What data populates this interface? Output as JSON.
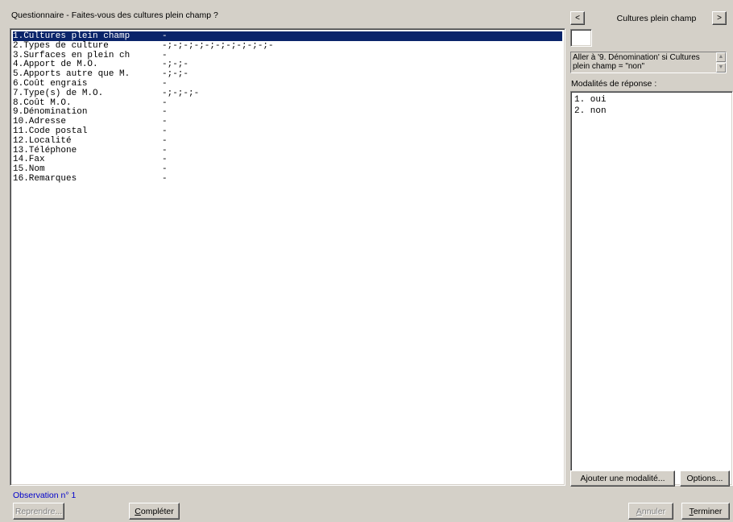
{
  "window": {
    "title": "Questionnaire - Faites-vous des cultures plein champ ?"
  },
  "questions": [
    {
      "label": "1.Cultures plein champ",
      "value": "-"
    },
    {
      "label": "2.Types de culture",
      "value": "-;-;-;-;-;-;-;-;-;-;-"
    },
    {
      "label": "3.Surfaces en plein ch",
      "value": "-"
    },
    {
      "label": "4.Apport de M.O.",
      "value": "-;-;-"
    },
    {
      "label": "5.Apports autre que M.",
      "value": "-;-;-"
    },
    {
      "label": "6.Coût engrais",
      "value": "-"
    },
    {
      "label": "7.Type(s) de M.O.",
      "value": "-;-;-;-"
    },
    {
      "label": "8.Coût M.O.",
      "value": "-"
    },
    {
      "label": "9.Dénomination",
      "value": "-"
    },
    {
      "label": "10.Adresse",
      "value": "-"
    },
    {
      "label": "11.Code postal",
      "value": "-"
    },
    {
      "label": "12.Localité",
      "value": "-"
    },
    {
      "label": "13.Téléphone",
      "value": "-"
    },
    {
      "label": "14.Fax",
      "value": "-"
    },
    {
      "label": "15.Nom",
      "value": "-"
    },
    {
      "label": "16.Remarques",
      "value": "-"
    }
  ],
  "selected_index": 0,
  "right_panel": {
    "prev_label": "<",
    "next_label": ">",
    "current_question": "Cultures plein champ",
    "goto_rule": "Aller à '9. Dénomination' si Cultures plein champ = \"non\"",
    "modalities_label": "Modalités de réponse :",
    "modalities": [
      "1. oui",
      "2. non"
    ],
    "add_modality_button": "Ajouter une modalité...",
    "options_button": "Options..."
  },
  "footer": {
    "observation": "Observation n° 1",
    "reprendre_button": "Reprendre...",
    "completer_button": "Compléter",
    "annuler_button": "Annuler",
    "terminer_button": "Terminer"
  },
  "colors": {
    "selection": "#0a246a",
    "observation_text": "#0000cc",
    "face": "#d4d0c8"
  }
}
